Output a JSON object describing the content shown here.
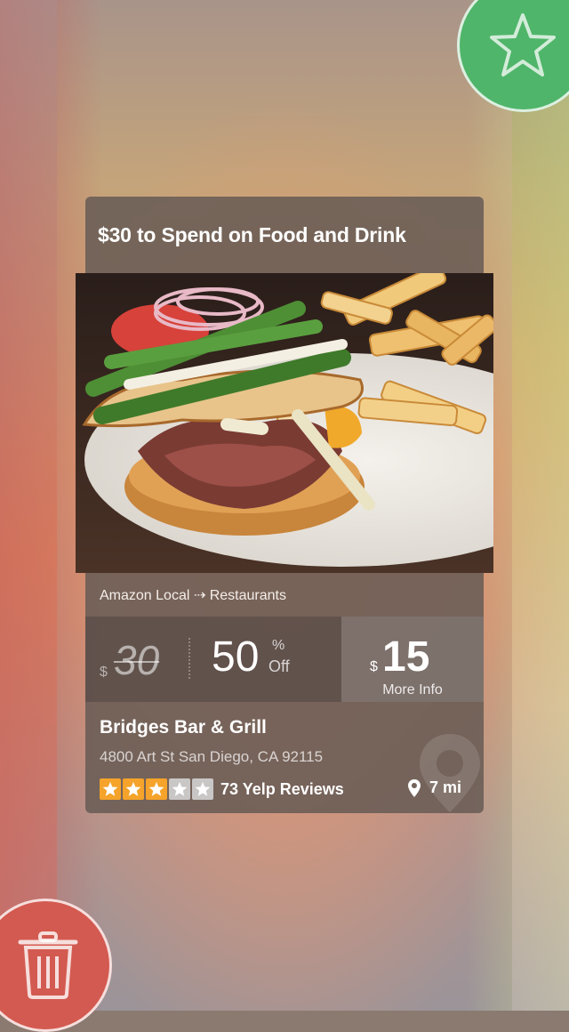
{
  "deal": {
    "title": "$30 to Spend on Food and Drink",
    "breadcrumb": "Amazon Local ⇢ Restaurants",
    "image_alt": "burger with asparagus and fries",
    "price": {
      "currency": "$",
      "original": "30",
      "discount": "50",
      "percent_symbol": "%",
      "off_label": "Off",
      "current": "15",
      "more_info_label": "More Info"
    },
    "business": {
      "name": "Bridges Bar & Grill",
      "address": "4800 Art St San Diego, CA 92115",
      "rating_stars": 3,
      "rating_max": 5,
      "reviews": "73 Yelp Reviews",
      "distance": "7 mi"
    }
  },
  "actions": {
    "favorite_icon": "star-icon",
    "discard_icon": "trash-icon"
  },
  "colors": {
    "favorite": "#4fb56a",
    "discard": "#d35a50",
    "star_on": "#f5a32a",
    "star_off": "#c9c6c6"
  }
}
